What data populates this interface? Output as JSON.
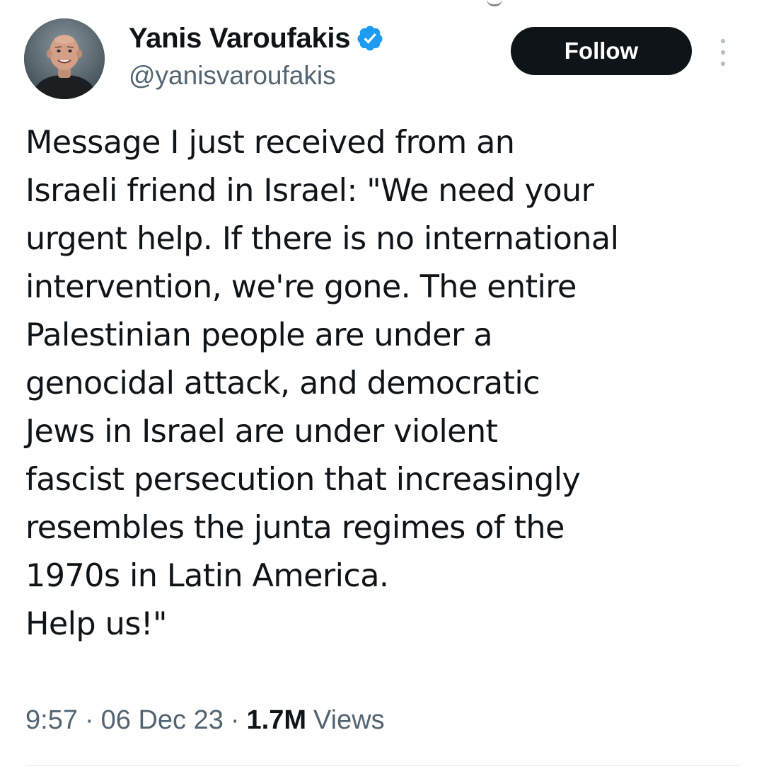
{
  "author": {
    "display_name": "Yanis Varoufakis",
    "handle": "@yanisvaroufakis",
    "verified": true,
    "avatar_icon": "profile-photo"
  },
  "actions": {
    "follow_label": "Follow",
    "more_icon": "more-vertical-icon"
  },
  "tweet": {
    "text": "Message I just received from an\nIsraeli friend in Israel: \"We need your\nurgent help. If there is no international\nintervention, we're gone. The entire\nPalestinian people are under a\ngenocidal attack, and democratic\nJews in Israel are under violent\nfascist persecution that increasingly\nresembles the junta regimes of the\n1970s in Latin America.\nHelp us!\""
  },
  "meta": {
    "time": "9:57",
    "separator": "·",
    "date": "06 Dec 23",
    "views_count": "1.7M",
    "views_label": "Views"
  },
  "colors": {
    "text_primary": "#0f1419",
    "text_secondary": "#536471",
    "verified_badge": "#1d9bf0",
    "follow_button_bg": "#0f1419",
    "follow_button_text": "#ffffff"
  }
}
